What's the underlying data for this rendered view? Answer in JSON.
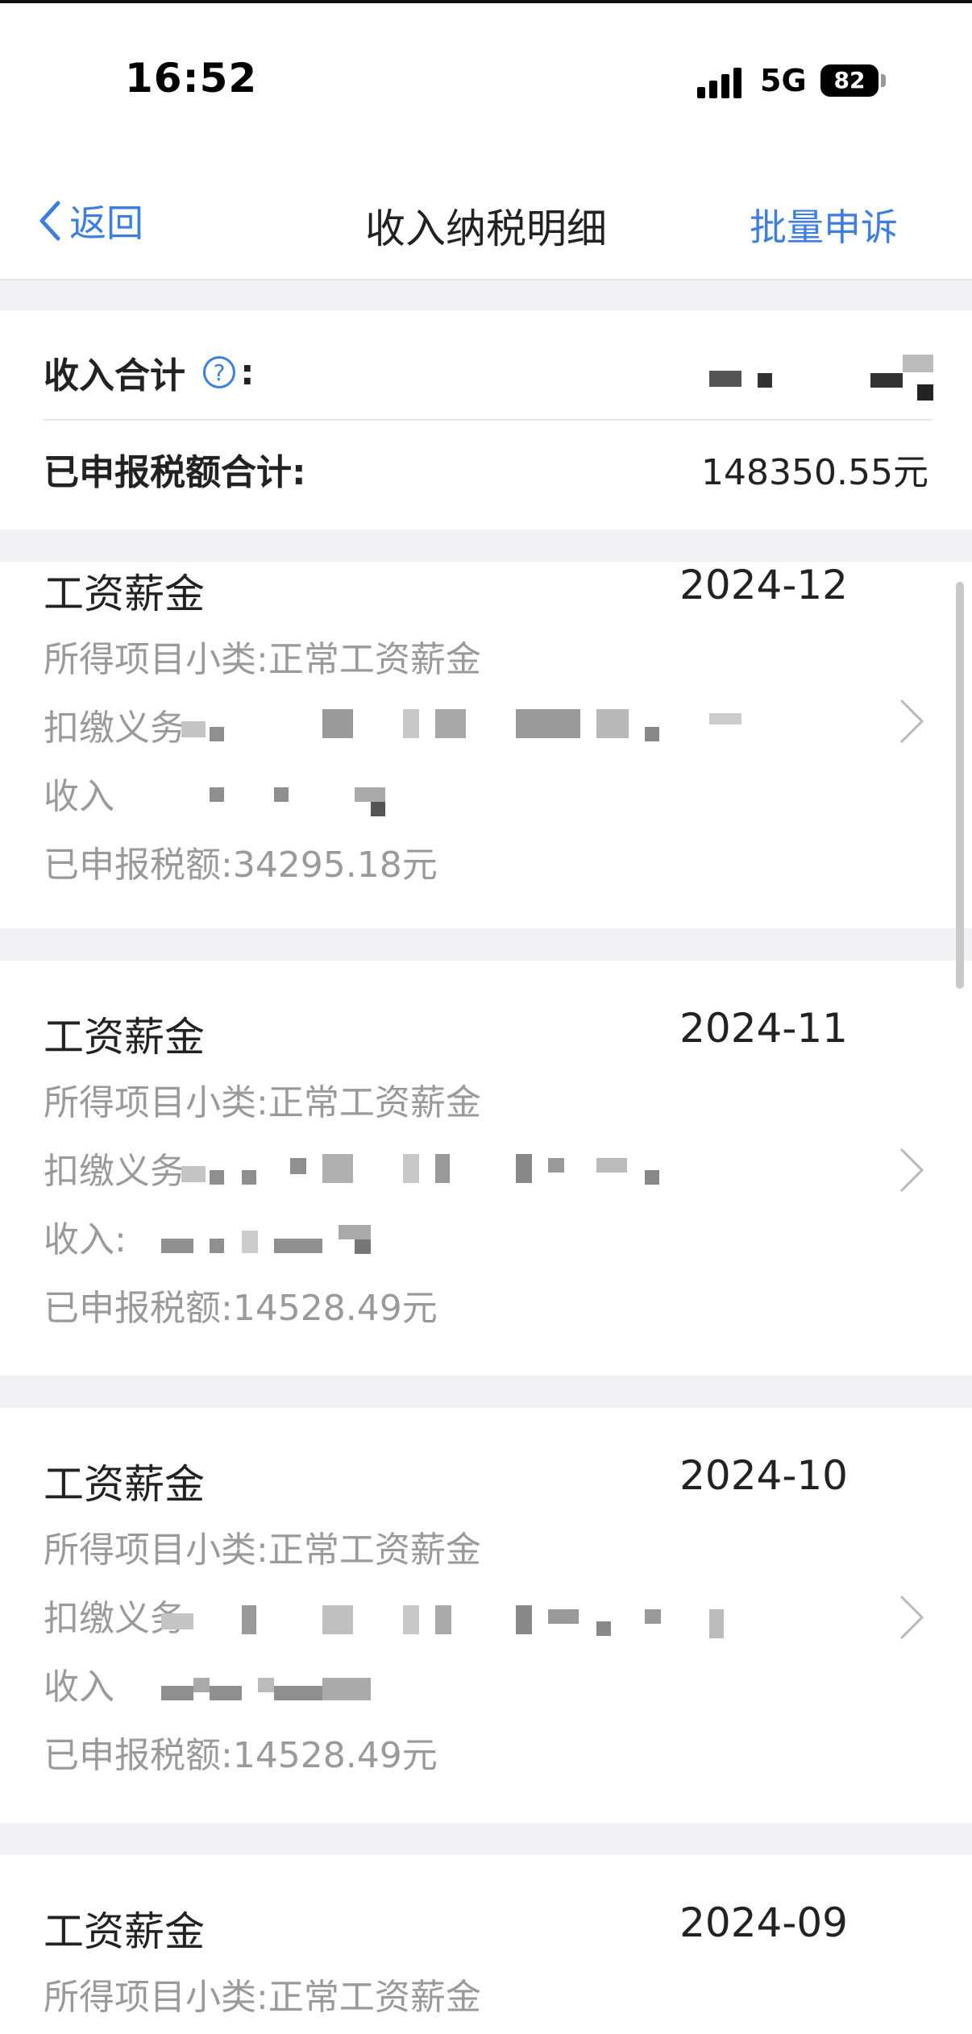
{
  "status": {
    "time": "16:52",
    "network": "5G",
    "battery": "82"
  },
  "nav": {
    "back_label": "返回",
    "title": "收入纳税明细",
    "action_label": "批量申诉"
  },
  "summary": {
    "income_label": "收入合计",
    "colon": ":",
    "declared_tax_label": "已申报税额合计:",
    "declared_tax_value": "148350.55元"
  },
  "records": [
    {
      "type": "工资薪金",
      "period": "2024-12",
      "subcategory": "所得项目小类:正常工资薪金",
      "withholder_label": "扣缴义务",
      "income_label": "收入",
      "tax": "已申报税额:34295.18元"
    },
    {
      "type": "工资薪金",
      "period": "2024-11",
      "subcategory": "所得项目小类:正常工资薪金",
      "withholder_label": "扣缴义务",
      "income_label": "收入:",
      "tax": "已申报税额:14528.49元"
    },
    {
      "type": "工资薪金",
      "period": "2024-10",
      "subcategory": "所得项目小类:正常工资薪金",
      "withholder_label": "扣缴义务",
      "income_label": "收入",
      "tax": "已申报税额:14528.49元"
    },
    {
      "type": "工资薪金",
      "period": "2024-09",
      "subcategory": "所得项目小类:正常工资薪金"
    }
  ],
  "colors": {
    "accent": "#3d7ee0",
    "background": "#f1f2f5",
    "muted_text": "#9a9a9a"
  }
}
